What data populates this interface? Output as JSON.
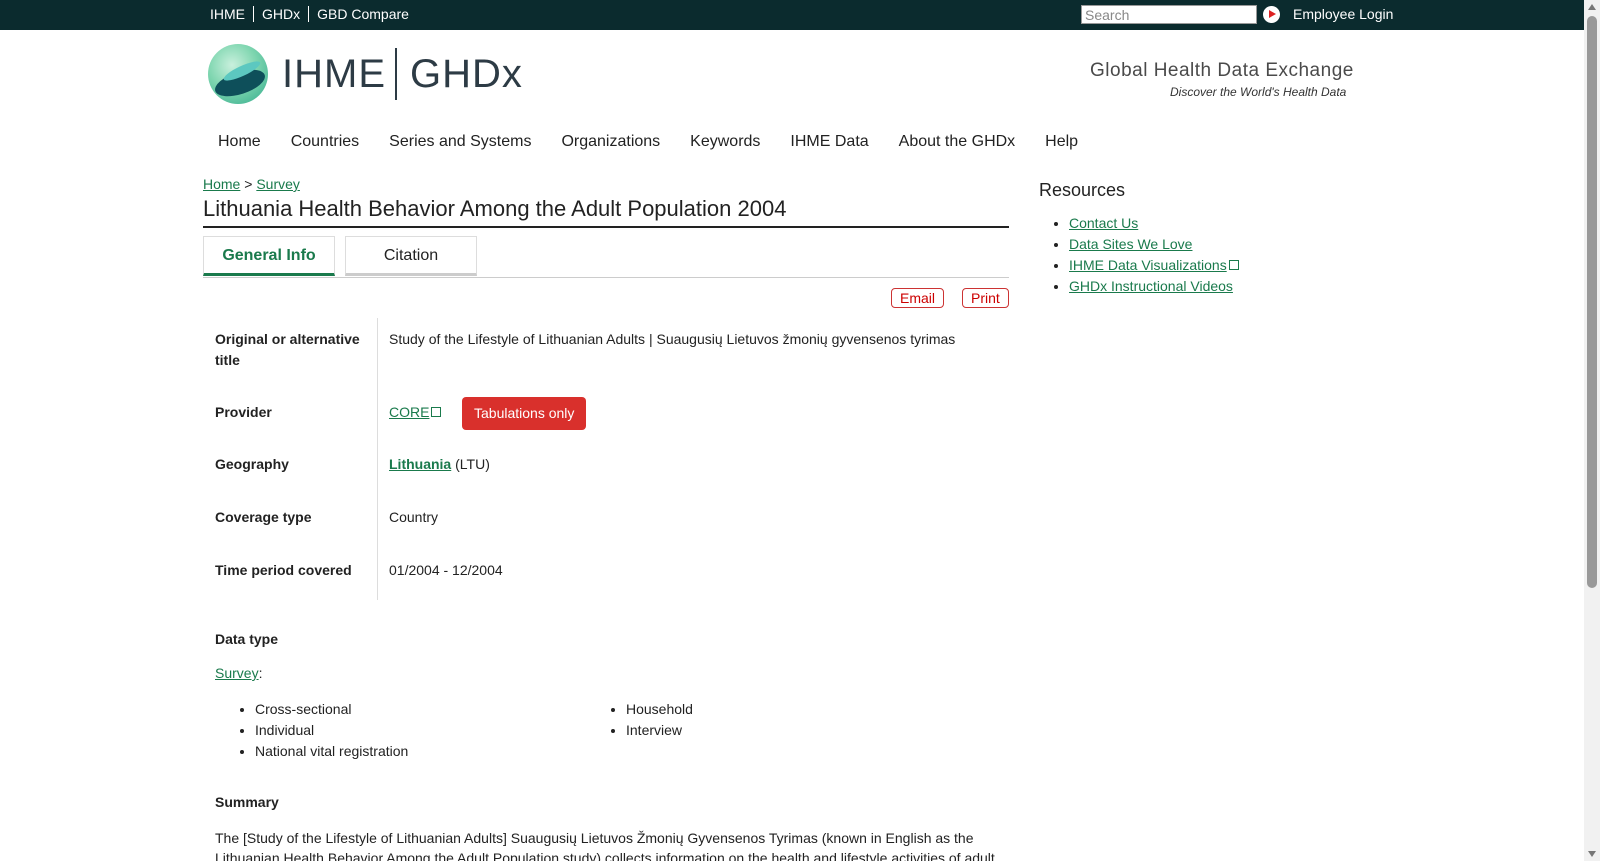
{
  "topbar": {
    "links": [
      "IHME",
      "GHDx",
      "GBD Compare"
    ],
    "search_placeholder": "Search",
    "employee_login": "Employee Login"
  },
  "header": {
    "logo_left": "IHME",
    "logo_right": "GHDx",
    "tagline": "Global Health Data Exchange",
    "tagline_sub": "Discover the World's Health Data"
  },
  "nav": [
    "Home",
    "Countries",
    "Series and Systems",
    "Organizations",
    "Keywords",
    "IHME Data",
    "About the GHDx",
    "Help"
  ],
  "breadcrumb": {
    "home": "Home",
    "sep": ">",
    "current": "Survey"
  },
  "title": "Lithuania Health Behavior Among the Adult Population 2004",
  "tabs": {
    "general": "General Info",
    "citation": "Citation"
  },
  "actions": {
    "email": "Email",
    "print": "Print"
  },
  "details": {
    "alt_title_label": "Original or alternative title",
    "alt_title_value": "Study of the Lifestyle of Lithuanian Adults | Suaugusių Lietuvos žmonių gyvensenos tyrimas",
    "provider_label": "Provider",
    "provider_value": "CORE",
    "provider_badge": "Tabulations only",
    "geography_label": "Geography",
    "geography_value": "Lithuania",
    "geography_code": "(LTU)",
    "coverage_label": "Coverage type",
    "coverage_value": "Country",
    "time_label": "Time period covered",
    "time_value": "01/2004 - 12/2004"
  },
  "data_type": {
    "heading": "Data type",
    "link": "Survey",
    "left_items": [
      "Cross-sectional",
      "Individual",
      "National vital registration"
    ],
    "right_items": [
      "Household",
      "Interview"
    ]
  },
  "summary": {
    "heading": "Summary",
    "text": "The [Study of the Lifestyle of Lithuanian Adults] Suaugusių Lietuvos Žmonių Gyvensenos Tyrimas (known in English as the Lithuanian Health Behavior Among the Adult Population study) collects information on the health and lifestyle activities of adult"
  },
  "resources": {
    "heading": "Resources",
    "items": [
      "Contact Us",
      "Data Sites We Love",
      "IHME Data Visualizations",
      "GHDx Instructional Videos"
    ]
  }
}
